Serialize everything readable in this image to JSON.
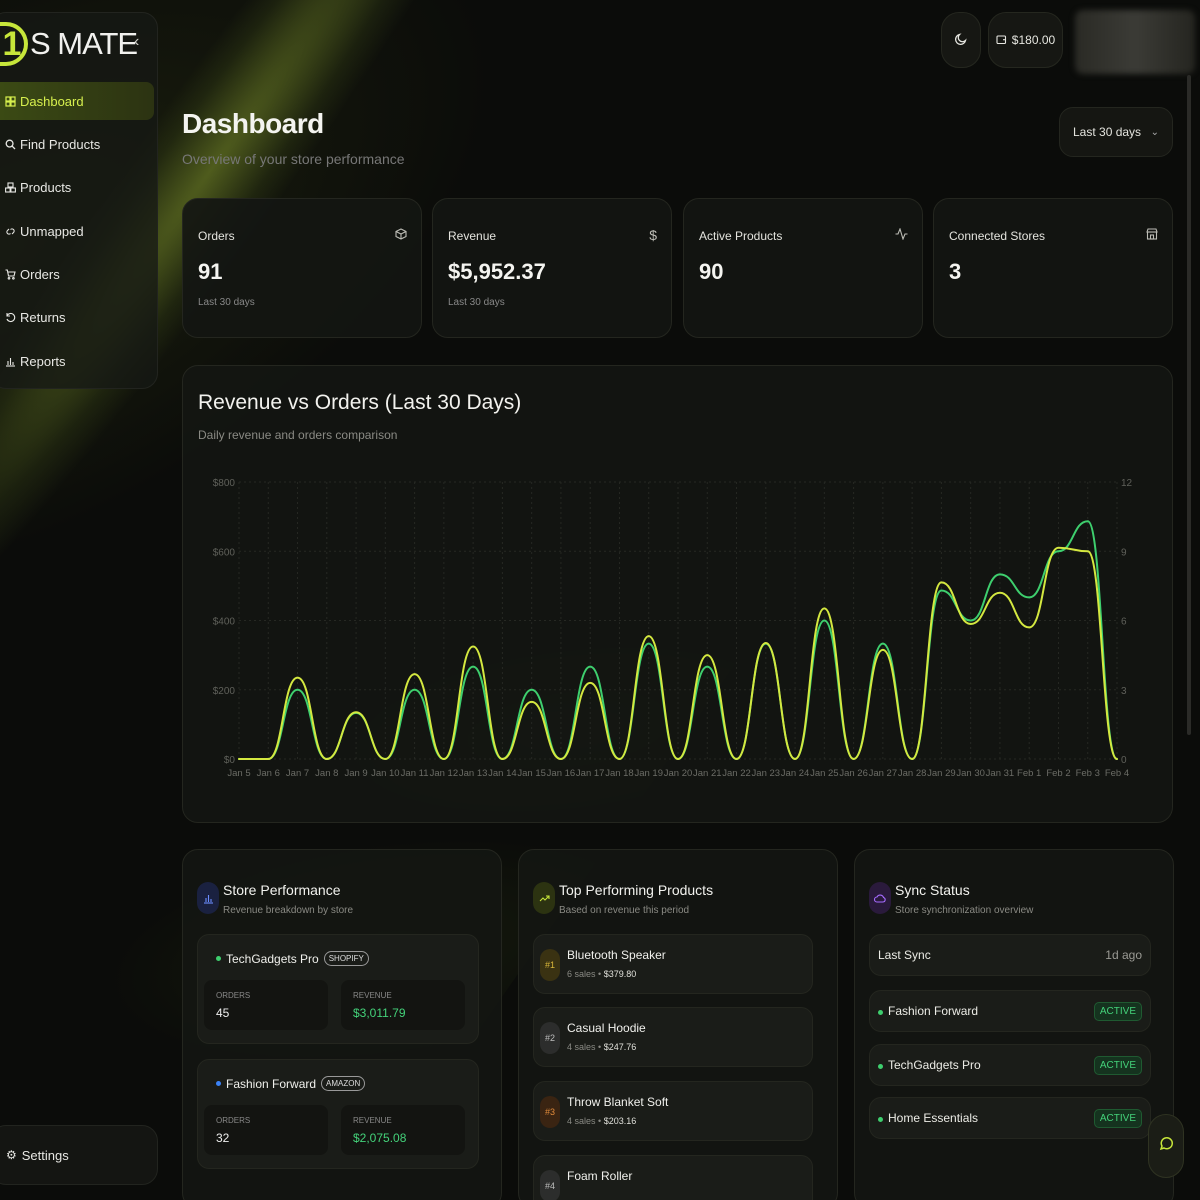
{
  "brand": {
    "name": "S MATE",
    "logo_glyph": "1"
  },
  "sidebar": {
    "collapse_icon": "chevron-left-icon",
    "items": [
      {
        "label": "Dashboard",
        "icon": "grid-icon",
        "active": true
      },
      {
        "label": "Find Products",
        "icon": "search-icon"
      },
      {
        "label": "Products",
        "icon": "boxes-icon"
      },
      {
        "label": "Unmapped",
        "icon": "unlink-icon"
      },
      {
        "label": "Orders",
        "icon": "cart-icon"
      },
      {
        "label": "Returns",
        "icon": "undo-icon"
      },
      {
        "label": "Reports",
        "icon": "bar-chart-icon"
      }
    ],
    "settings_label": "Settings"
  },
  "topbar": {
    "theme_icon": "moon-icon",
    "wallet_icon": "wallet-icon",
    "wallet_balance": "$180.00"
  },
  "header": {
    "title": "Dashboard",
    "subtitle": "Overview of your store performance",
    "range": "Last 30 days"
  },
  "stats": [
    {
      "label": "Orders",
      "value": "91",
      "sub": "Last 30 days",
      "icon": "box-icon"
    },
    {
      "label": "Revenue",
      "value": "$5,952.37",
      "sub": "Last 30 days",
      "icon": "dollar-icon"
    },
    {
      "label": "Active Products",
      "value": "90",
      "sub": "",
      "icon": "activity-icon"
    },
    {
      "label": "Connected Stores",
      "value": "3",
      "sub": "",
      "icon": "store-icon"
    }
  ],
  "chart_card": {
    "title": "Revenue vs Orders (Last 30 Days)",
    "subtitle": "Daily revenue and orders comparison"
  },
  "chart_data": {
    "type": "line",
    "x": [
      "Jan 5",
      "Jan 6",
      "Jan 7",
      "Jan 8",
      "Jan 9",
      "Jan 10",
      "Jan 11",
      "Jan 12",
      "Jan 13",
      "Jan 14",
      "Jan 15",
      "Jan 16",
      "Jan 17",
      "Jan 18",
      "Jan 19",
      "Jan 20",
      "Jan 21",
      "Jan 22",
      "Jan 23",
      "Jan 24",
      "Jan 25",
      "Jan 26",
      "Jan 27",
      "Jan 28",
      "Jan 29",
      "Jan 30",
      "Jan 31",
      "Feb 1",
      "Feb 2",
      "Feb 3",
      "Feb 4"
    ],
    "y_left_ticks": [
      "$0",
      "$200",
      "$400",
      "$600",
      "$800"
    ],
    "y_left_range": [
      0,
      800
    ],
    "y_right_ticks": [
      "0",
      "3",
      "6",
      "9",
      "12"
    ],
    "y_right_range": [
      0,
      12
    ],
    "series": [
      {
        "axis": "left",
        "color": "#d4e840",
        "values": [
          0,
          0,
          235,
          0,
          135,
          0,
          245,
          0,
          325,
          0,
          165,
          0,
          220,
          0,
          355,
          0,
          300,
          0,
          335,
          0,
          435,
          0,
          315,
          0,
          510,
          390,
          480,
          380,
          610,
          600,
          0
        ]
      },
      {
        "axis": "right",
        "color": "#3ecf6e",
        "values": [
          0,
          0,
          3,
          0,
          2,
          0,
          3,
          0,
          4,
          0,
          3,
          0,
          4,
          0,
          5,
          0,
          4,
          0,
          5,
          0,
          6,
          0,
          5,
          0,
          7.3,
          6,
          8,
          7,
          9,
          10.3,
          0
        ]
      }
    ],
    "grid": true
  },
  "store_performance": {
    "title": "Store Performance",
    "subtitle": "Revenue breakdown by store",
    "icon": "bar-chart-icon",
    "stores": [
      {
        "name": "TechGadgets Pro",
        "platform": "SHOPIFY",
        "dot": "#3ecf6e",
        "orders_label": "ORDERS",
        "orders": "45",
        "revenue_label": "REVENUE",
        "revenue": "$3,011.79"
      },
      {
        "name": "Fashion Forward",
        "platform": "AMAZON",
        "dot": "#3b82f6",
        "orders_label": "ORDERS",
        "orders": "32",
        "revenue_label": "REVENUE",
        "revenue": "$2,075.08"
      }
    ]
  },
  "top_products": {
    "title": "Top Performing Products",
    "subtitle": "Based on revenue this period",
    "icon": "trending-up-icon",
    "items": [
      {
        "rank": "#1",
        "name": "Bluetooth Speaker",
        "sales": "6 sales",
        "revenue": "$379.80",
        "rank_color": "#d9b73a",
        "rank_bg": "#3a3212"
      },
      {
        "rank": "#2",
        "name": "Casual Hoodie",
        "sales": "4 sales",
        "revenue": "$247.76",
        "rank_color": "#bdbdbd",
        "rank_bg": "#2c2d2c"
      },
      {
        "rank": "#3",
        "name": "Throw Blanket Soft",
        "sales": "4 sales",
        "revenue": "$203.16",
        "rank_color": "#e08a3a",
        "rank_bg": "#3a2412"
      },
      {
        "rank": "#4",
        "name": "Foam Roller",
        "sales": "",
        "revenue": "",
        "rank_color": "#bdbdbd",
        "rank_bg": "#2c2d2c"
      }
    ]
  },
  "sync_status": {
    "title": "Sync Status",
    "subtitle": "Store synchronization overview",
    "icon": "cloud-icon",
    "last_sync_label": "Last Sync",
    "last_sync_value": "1d ago",
    "stores": [
      {
        "name": "Fashion Forward",
        "status": "ACTIVE"
      },
      {
        "name": "TechGadgets Pro",
        "status": "ACTIVE"
      },
      {
        "name": "Home Essentials",
        "status": "ACTIVE"
      }
    ]
  },
  "chat": {
    "icon": "chat-icon"
  }
}
